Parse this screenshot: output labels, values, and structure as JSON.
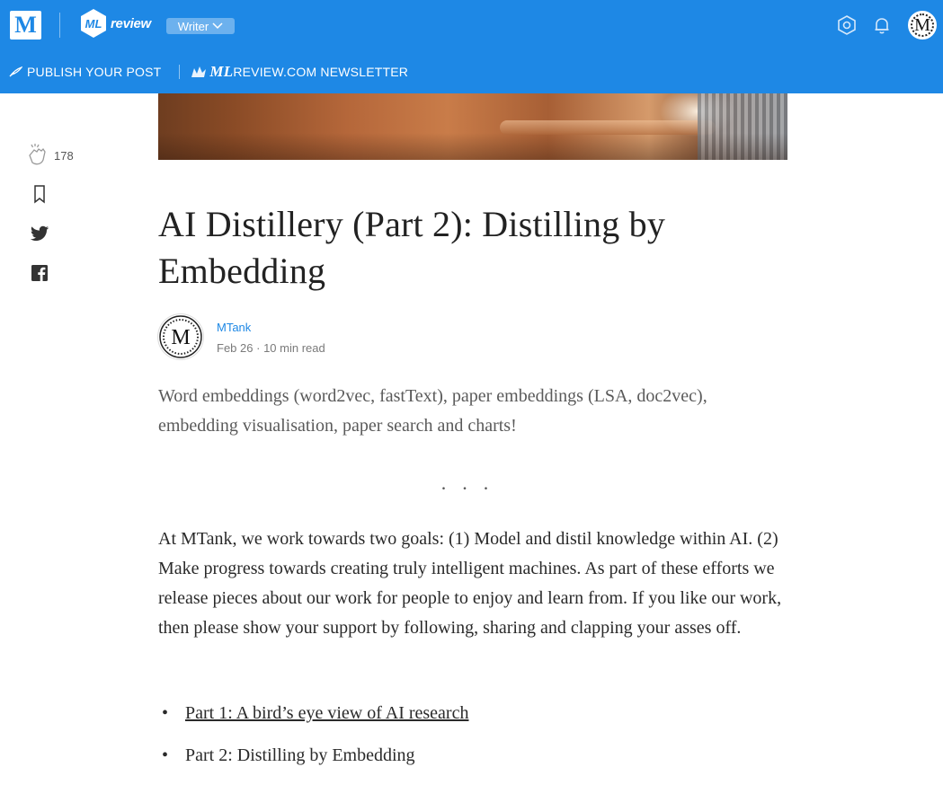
{
  "header": {
    "medium_logo": "M",
    "publication_logo_text": "review",
    "publication_logo_mark": "ML",
    "writer_button": "Writer",
    "colors": {
      "brand": "#1e88e5",
      "text_on_brand": "#ffffff"
    },
    "icons": [
      "settings-icon",
      "notifications-icon",
      "avatar"
    ]
  },
  "nav": {
    "publish_label": "PUBLISH YOUR POST",
    "newsletter_ml": "ML",
    "newsletter_label": "REVIEW.COM NEWSLETTER"
  },
  "share": {
    "clap_count": "178",
    "icons": [
      "clap-icon",
      "bookmark-icon",
      "twitter-icon",
      "facebook-icon"
    ]
  },
  "article": {
    "title": "AI Distillery (Part 2): Distilling by Embedding",
    "author": "MTank",
    "author_avatar_letter": "M",
    "date": "Feb 26",
    "meta_sep": "·",
    "read_time": "10 min read",
    "subtitle": "Word embeddings (word2vec, fastText), paper embeddings (LSA, doc2vec), embedding visualisation, paper search and charts!",
    "divider": "...",
    "paragraph": "At MTank, we work towards two goals: (1) Model and distil knowledge within AI. (2) Make progress towards creating truly intelligent machines. As part of these efforts we release pieces about our work for people to enjoy and learn from. If you like our work, then please show your support by following, sharing and clapping your asses off.",
    "list_bullet": "•",
    "list": [
      {
        "label": "Part 1: A bird’s eye view of AI research",
        "is_link": true
      },
      {
        "label": "Part 2: Distilling by Embedding",
        "is_link": false
      }
    ]
  }
}
